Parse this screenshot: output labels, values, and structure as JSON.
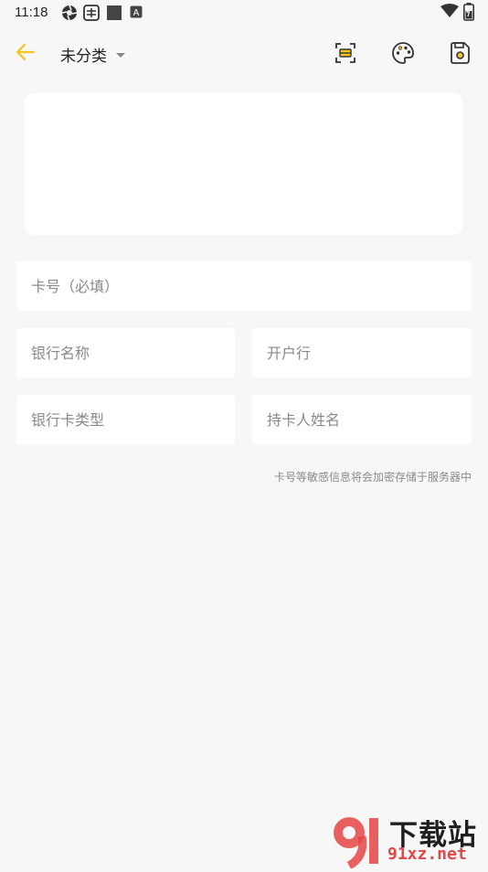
{
  "status_bar": {
    "time": "11:18",
    "icons": [
      "aperture-icon",
      "keyboard-icon",
      "square-icon",
      "a-notification-icon",
      "wifi-icon",
      "battery-icon"
    ]
  },
  "toolbar": {
    "back_icon": "back-arrow-icon",
    "category": "未分类",
    "scan_icon": "scan-card-icon",
    "palette_icon": "palette-icon",
    "save_icon": "save-icon",
    "accent_color": "#f5c518"
  },
  "form": {
    "card_number_placeholder": "卡号（必填）",
    "bank_name_placeholder": "银行名称",
    "branch_placeholder": "开户行",
    "card_type_placeholder": "银行卡类型",
    "holder_placeholder": "持卡人姓名",
    "notice": "卡号等敏感信息将会加密存储于服务器中"
  },
  "watermark": {
    "text": "下载站",
    "url": "91xz.net",
    "color": "#e54545"
  }
}
